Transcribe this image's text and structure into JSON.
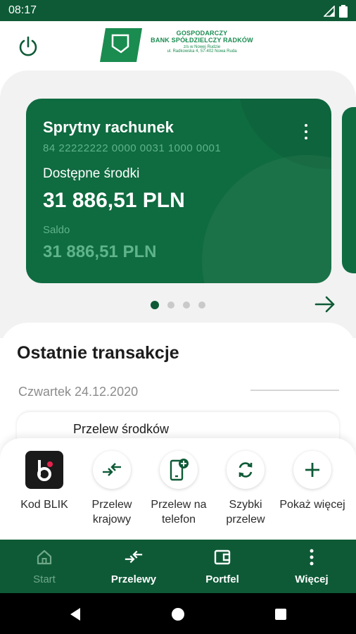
{
  "status_bar": {
    "time": "08:17"
  },
  "header": {
    "logo": {
      "line1": "GOSPODARCZY",
      "line2": "BANK SPÓŁDZIELCZY RADKÓW",
      "line3": "z/s w Nowej Rudzie",
      "line4": "ul. Radkowska 4, 57-402 Nowa Ruda"
    }
  },
  "account_card": {
    "title": "Sprytny rachunek",
    "number": "84 22222222 0000 0031 1000 0001",
    "available_label": "Dostępne środki",
    "available_value": "31 886,51 PLN",
    "saldo_label": "Saldo",
    "saldo_value": "31 886,51 PLN"
  },
  "pager": {
    "count": 4,
    "active": 0
  },
  "transactions": {
    "title": "Ostatnie transakcje",
    "date": "Czwartek 24.12.2020",
    "items": [
      {
        "title": "Przelew środków"
      }
    ]
  },
  "quick_actions": [
    {
      "label": "Kod BLIK",
      "icon": "blik-icon"
    },
    {
      "label": "Przelew krajowy",
      "icon": "transfer-arrows-icon"
    },
    {
      "label": "Przelew na telefon",
      "icon": "phone-transfer-icon"
    },
    {
      "label": "Szybki przelew",
      "icon": "refresh-icon"
    },
    {
      "label": "Pokaż więcej",
      "icon": "plus-icon"
    }
  ],
  "bottom_nav": [
    {
      "label": "Start",
      "icon": "home-icon",
      "active": true
    },
    {
      "label": "Przelewy",
      "icon": "transfer-arrows-icon",
      "active": false
    },
    {
      "label": "Portfel",
      "icon": "wallet-icon",
      "active": false
    },
    {
      "label": "Więcej",
      "icon": "more-vertical-icon",
      "active": false
    }
  ],
  "colors": {
    "brand_dark": "#0e5a36",
    "card": "#0f6b40",
    "accent_green": "#1a8c50",
    "muted_green": "#5fb48a"
  }
}
